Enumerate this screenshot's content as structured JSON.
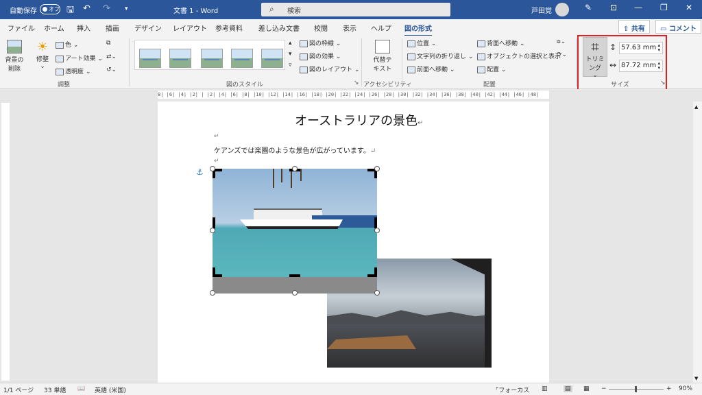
{
  "titlebar": {
    "autosave_label": "自動保存",
    "autosave_state": "オフ",
    "doc_title": "文書 1  -  Word",
    "search_placeholder": "検索",
    "user_name": "戸田覚",
    "icons": [
      "save-icon",
      "undo-icon",
      "redo-icon",
      "customize-icon",
      "pen-icon",
      "ribbon-display-icon",
      "minimize-icon",
      "restore-icon",
      "close-icon"
    ]
  },
  "tabs": [
    "ファイル",
    "ホーム",
    "挿入",
    "描画",
    "デザイン",
    "レイアウト",
    "参考資料",
    "差し込み文書",
    "校閲",
    "表示",
    "ヘルプ",
    "図の形式"
  ],
  "share": {
    "share_label": "共有",
    "comment_label": "コメント"
  },
  "ribbon": {
    "remove_bg_line1": "背景の",
    "remove_bg_line2": "削除",
    "corrections": "修整",
    "color": "色",
    "art_effects": "アート効果",
    "transparency": "透明度",
    "group_adjust": "調整",
    "group_styles": "図のスタイル",
    "border": "図の枠線",
    "effects": "図の効果",
    "layout": "図のレイアウト",
    "alt_text_line1": "代替テ",
    "alt_text_line2": "キスト",
    "group_accessibility": "アクセシビリティ",
    "position": "位置",
    "wrap_text": "文字列の折り返し",
    "bring_forward": "前面へ移動",
    "send_backward": "背面へ移動",
    "selection_pane": "オブジェクトの選択と表示",
    "align": "配置",
    "group_arrange": "配置",
    "crop": "トリミング",
    "height": "57.63 mm",
    "width": "87.72 mm",
    "group_size": "サイズ"
  },
  "ruler_text": "8| |6| |4| |2| |  |2| |4| |6| |8| |10| |12| |14| |16| |18| |20| |22| |24| |26| |28| |30| |32| |34| |36| |38| |40| |42| |44| |46| |48|",
  "document": {
    "title": "オーストラリアの景色",
    "paragraph": "ケアンズでは楽園のような景色が広がっています。",
    "para_mark": "↵"
  },
  "status": {
    "page": "1/1 ページ",
    "words": "33 単語",
    "language": "英語 (米国)",
    "focus": "フォーカス",
    "zoom": "90%"
  }
}
